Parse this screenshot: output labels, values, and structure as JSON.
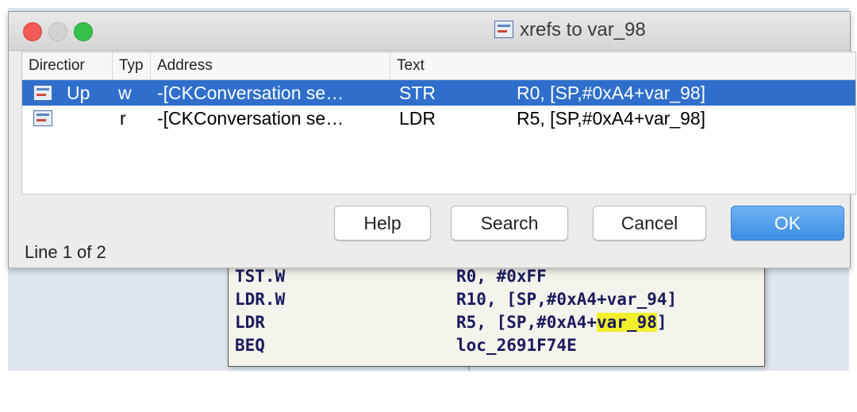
{
  "window": {
    "title": "xrefs to var_98",
    "traffic_lights": [
      "close",
      "minimize",
      "zoom"
    ]
  },
  "list": {
    "columns": [
      "Directior",
      "Typ",
      "Address",
      "Text"
    ],
    "rows": [
      {
        "icon": "xref-icon",
        "direction": "Up",
        "type": "w",
        "address": "-[CKConversation se…",
        "mnemonic": "STR",
        "operands": "R0, [SP,#0xA4+var_98]",
        "selected": true
      },
      {
        "icon": "xref-icon",
        "direction": "",
        "type": "r",
        "address": "-[CKConversation se…",
        "mnemonic": "LDR",
        "operands": "R5, [SP,#0xA4+var_98]",
        "selected": false
      }
    ]
  },
  "buttons": {
    "help": "Help",
    "search": "Search",
    "cancel": "Cancel",
    "ok": "OK"
  },
  "status": "Line 1 of 2",
  "disassembly": {
    "lines": [
      {
        "mnemonic": "TST.W",
        "operands": "R0, #0xFF"
      },
      {
        "mnemonic": "LDR.W",
        "operands": "R10, [SP,#0xA4+var_94]"
      },
      {
        "mnemonic": "LDR",
        "operands_pre": "R5, [SP,#0xA4+",
        "operands_hl": "var_98",
        "operands_post": "]"
      },
      {
        "mnemonic": "BEQ",
        "operands": "loc_2691F74E"
      }
    ],
    "highlight_color": "#f2ef2c"
  },
  "colors": {
    "selection": "#2f6fcb",
    "ok_button": "#3c8ee4",
    "asm_text": "#1a1a5e"
  }
}
